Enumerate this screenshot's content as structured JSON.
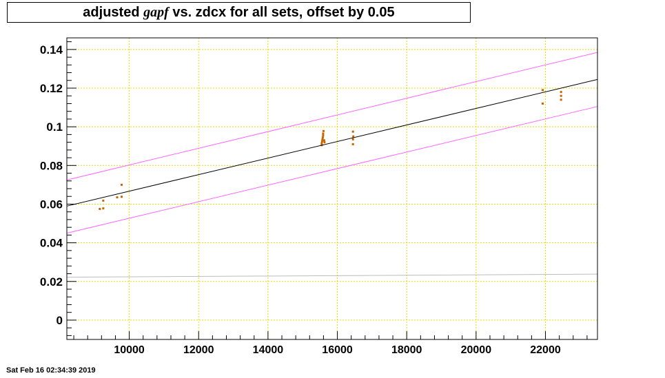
{
  "chart_data": {
    "type": "scatter",
    "title": {
      "prefix": "adjusted ",
      "italic": "gapf",
      "suffix": " vs. zdcx for all sets, offset by 0.05"
    },
    "xlabel": "",
    "ylabel": "",
    "xlim": [
      8200,
      23500
    ],
    "ylim": [
      -0.01,
      0.146
    ],
    "xticks": [
      10000,
      12000,
      14000,
      16000,
      18000,
      20000,
      22000
    ],
    "xtick_labels": [
      "10000",
      "12000",
      "14000",
      "16000",
      "18000",
      "20000",
      "22000"
    ],
    "yticks": [
      0,
      0.02,
      0.04,
      0.06,
      0.08,
      0.1,
      0.12,
      0.14
    ],
    "ytick_labels": [
      "0",
      "0.02",
      "0.04",
      "0.06",
      "0.08",
      "0.1",
      "0.12",
      "0.14"
    ],
    "grid": true,
    "series": [
      {
        "kind": "points",
        "color": "#c86400",
        "points": [
          [
            9150,
            0.0575
          ],
          [
            9250,
            0.0578
          ],
          [
            9250,
            0.0618
          ],
          [
            9650,
            0.0635
          ],
          [
            9780,
            0.0638
          ],
          [
            9780,
            0.07
          ],
          [
            15550,
            0.0905
          ],
          [
            15550,
            0.0915
          ],
          [
            15560,
            0.0925
          ],
          [
            15570,
            0.0935
          ],
          [
            15580,
            0.0945
          ],
          [
            15590,
            0.0955
          ],
          [
            15590,
            0.0965
          ],
          [
            15600,
            0.0978
          ],
          [
            15620,
            0.093
          ],
          [
            15630,
            0.092
          ],
          [
            16450,
            0.091
          ],
          [
            16450,
            0.0935
          ],
          [
            16460,
            0.095
          ],
          [
            16450,
            0.0975
          ],
          [
            21920,
            0.112
          ],
          [
            21920,
            0.119
          ],
          [
            22450,
            0.114
          ],
          [
            22450,
            0.116
          ],
          [
            22450,
            0.118
          ]
        ]
      },
      {
        "kind": "line",
        "color": "#000000",
        "points": [
          [
            8200,
            0.059
          ],
          [
            23500,
            0.1245
          ]
        ]
      },
      {
        "kind": "line",
        "color": "#ff66ff",
        "points": [
          [
            8200,
            0.0725
          ],
          [
            23500,
            0.1385
          ]
        ]
      },
      {
        "kind": "line",
        "color": "#ff66ff",
        "points": [
          [
            8200,
            0.045
          ],
          [
            23500,
            0.1105
          ]
        ]
      },
      {
        "kind": "line",
        "color": "#bbbbbb",
        "points": [
          [
            8200,
            0.0222
          ],
          [
            23500,
            0.0238
          ]
        ]
      }
    ]
  },
  "timestamp": "Sat Feb 16 02:34:39 2019"
}
